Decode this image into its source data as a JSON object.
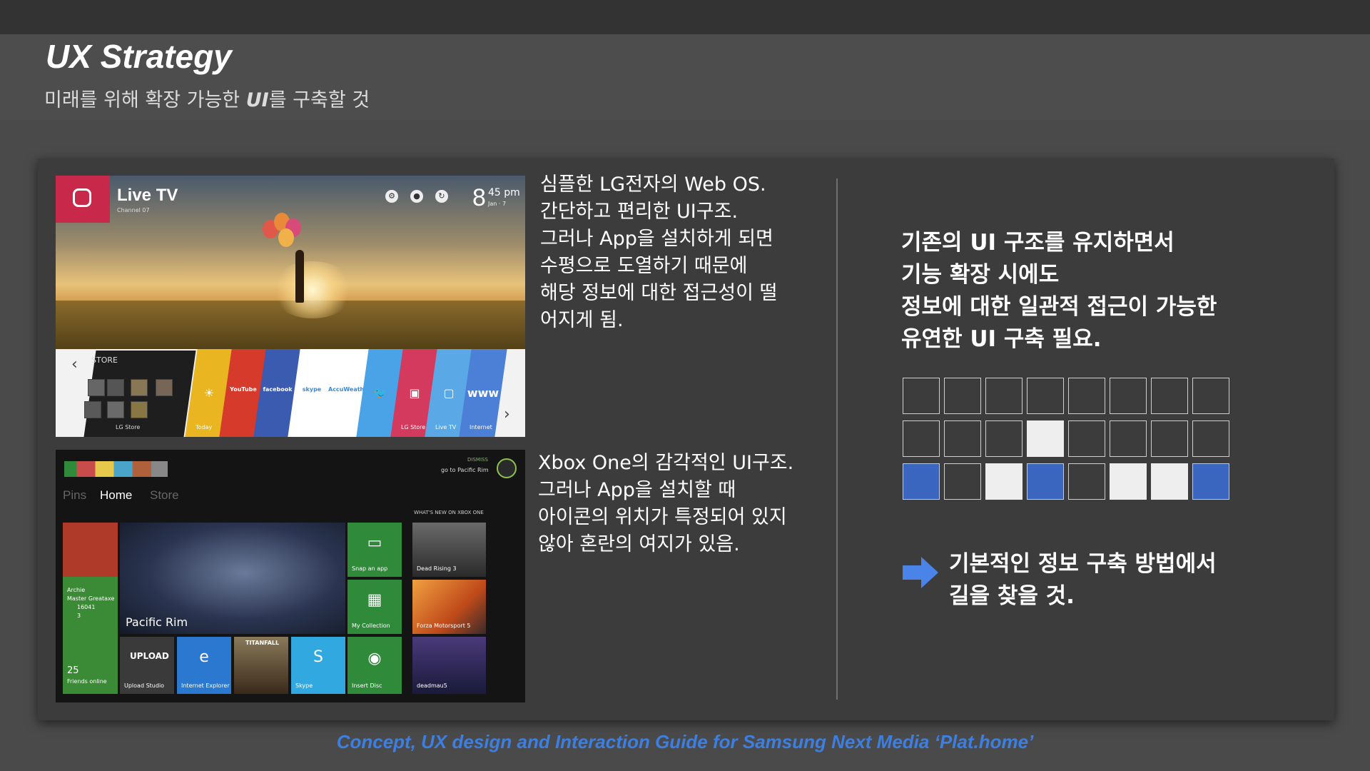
{
  "slide": {
    "title": "UX Strategy",
    "subtitle_before": "미래를 위해 확장 가능한 ",
    "subtitle_em": "UI",
    "subtitle_after": "를 구축할 것",
    "footer": "Concept, UX design and Interaction Guide for Samsung Next Media ‘Plat.home’"
  },
  "lg_screen": {
    "app_title": "Live TV",
    "channel": "Channel 07",
    "time_hour": "8",
    "time_min": "45 pm",
    "date": "Jan · 7",
    "store_header": "STORE",
    "store_label": "LG Store",
    "tiles": [
      {
        "icon": "Today-icon",
        "glyph": "☀",
        "label": "Today",
        "color": "#e9b520"
      },
      {
        "icon": "youtube-icon",
        "glyph": "YouTube",
        "label": "",
        "color": "#d63a2a"
      },
      {
        "icon": "facebook-icon",
        "glyph": "facebook",
        "label": "",
        "color": "#3b5bb0"
      },
      {
        "icon": "skype-icon",
        "glyph": "skype",
        "label": "",
        "color": "#ffffff"
      },
      {
        "icon": "accuweather-icon",
        "glyph": "AccuWeather",
        "label": "",
        "color": "#ffffff"
      },
      {
        "icon": "twitter-icon",
        "glyph": "🐦",
        "label": "",
        "color": "#4aa3e6"
      },
      {
        "icon": "lg-store-icon",
        "glyph": "▣",
        "label": "LG Store",
        "color": "#d43a5e"
      },
      {
        "icon": "live-tv-icon",
        "glyph": "▢",
        "label": "Live TV",
        "color": "#5aa8e6"
      },
      {
        "icon": "internet-icon",
        "glyph": "www",
        "label": "Internet",
        "color": "#4c7fd6"
      }
    ]
  },
  "xbox_screen": {
    "dismiss": "DISMISS",
    "goto": "go to Pacific Rim",
    "nav": [
      "Pins",
      "Home",
      "Store"
    ],
    "profile": {
      "name": "Archie",
      "title": "Master Greataxe",
      "score": "16041",
      "messages": "3",
      "friends": "25",
      "friends_label": "Friends online"
    },
    "feature_title": "Pacific Rim",
    "snap": "Snap an app",
    "collection": "My Collection",
    "insert_disc": "Insert Disc",
    "upload_logo": "UPLOAD",
    "upload_label": "Upload Studio",
    "ie_label": "Internet Explorer",
    "titanfall": "TITANFALL",
    "skype_label": "Skype",
    "whats_new": "WHAT'S NEW ON XBOX ONE",
    "new_items": [
      "Dead Rising 3",
      "Forza Motorsport 5",
      "deadmau5"
    ]
  },
  "lg_description": [
    "심플한 LG전자의 Web OS.",
    "간단하고 편리한 UI구조.",
    "그러나 App을 설치하게 되면",
    "수평으로 도열하기 때문에",
    "해당 정보에 대한 접근성이 떨",
    "어지게 됨."
  ],
  "xbox_description": [
    "Xbox One의 감각적인 UI구조.",
    "그러나 App을 설치할 때",
    "아이콘의 위치가 특정되어 있지",
    "않아 혼란의 여지가 있음."
  ],
  "right_heading": [
    "기존의 UI 구조를 유지하면서",
    "기능 확장 시에도",
    "정보에 대한 일관적 접근이 가능한",
    "유연한 UI 구축 필요."
  ],
  "grid": {
    "rows": [
      [
        "e",
        "e",
        "e",
        "e",
        "e",
        "e",
        "e",
        "e"
      ],
      [
        "e",
        "e",
        "e",
        "w",
        "e",
        "e",
        "e",
        "e"
      ],
      [
        "b",
        "e",
        "w",
        "b",
        "e",
        "w",
        "w",
        "b"
      ]
    ],
    "colors": {
      "blue": "#3a66c0",
      "white": "#eeeeee",
      "arrow": "#4a84e8"
    }
  },
  "bottom_note": [
    "기본적인 정보 구축 방법에서",
    "길을 찾을 것."
  ]
}
